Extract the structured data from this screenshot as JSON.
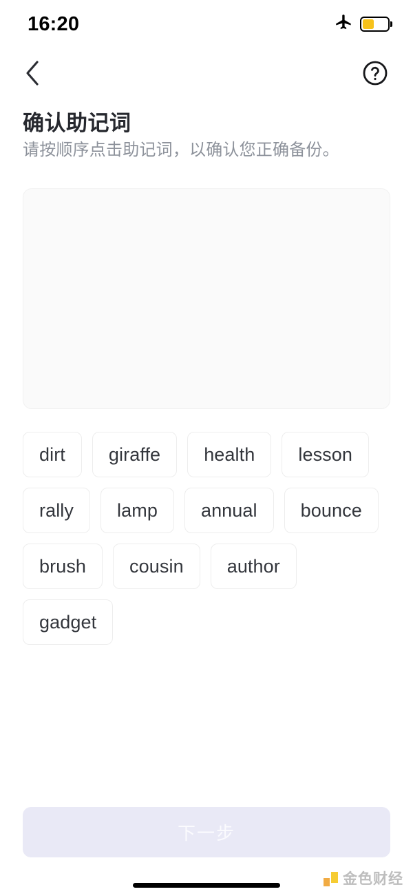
{
  "status_bar": {
    "time": "16:20",
    "airplane_icon": "airplane-icon",
    "battery_icon": "battery-icon",
    "battery_level_percent": 45,
    "battery_fill_color": "#f7c21b"
  },
  "nav_bar": {
    "back_icon": "chevron-left-icon",
    "help_icon": "question-mark-circle-icon"
  },
  "header": {
    "title": "确认助记词",
    "subtitle": "请按顺序点击助记词，以确认您正确备份。"
  },
  "answer_box": {
    "selected_words": []
  },
  "word_pool": {
    "words": [
      "dirt",
      "giraffe",
      "health",
      "lesson",
      "rally",
      "lamp",
      "annual",
      "bounce",
      "brush",
      "cousin",
      "author",
      "gadget"
    ]
  },
  "footer": {
    "primary_button_label": "下一步",
    "primary_button_disabled": true,
    "primary_button_bg": "#e9e9f6",
    "primary_button_text_color": "#fbfbfe"
  },
  "watermark": {
    "text": "金色财经",
    "logo_color_primary": "#f5c518",
    "logo_color_secondary": "#f0a02a"
  }
}
